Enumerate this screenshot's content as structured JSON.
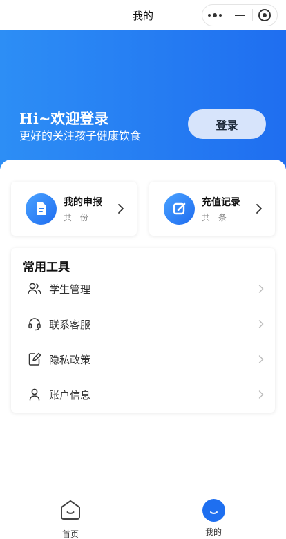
{
  "navbar": {
    "title": "我的"
  },
  "hero": {
    "title": "Hi~欢迎登录",
    "subtitle": "更好的关注孩子健康饮食",
    "login_label": "登录"
  },
  "stats": [
    {
      "title": "我的申报",
      "count_text": "共 份",
      "icon": "document-icon"
    },
    {
      "title": "充值记录",
      "count_text": "共 条",
      "icon": "edit-icon"
    }
  ],
  "tools": {
    "title": "常用工具",
    "items": [
      {
        "label": "学生管理",
        "icon": "users-icon"
      },
      {
        "label": "联系客服",
        "icon": "headset-icon"
      },
      {
        "label": "隐私政策",
        "icon": "pen-document-icon"
      },
      {
        "label": "账户信息",
        "icon": "user-icon"
      }
    ]
  },
  "tabbar": {
    "items": [
      {
        "label": "首页",
        "icon": "home-icon",
        "active": false
      },
      {
        "label": "我的",
        "icon": "profile-smile-icon",
        "active": true
      }
    ]
  },
  "colors": {
    "accent": "#1e6ff0",
    "hero_start": "#2d8ef5",
    "hero_end": "#1f6ef0",
    "login_button": "#d7e4fb"
  }
}
